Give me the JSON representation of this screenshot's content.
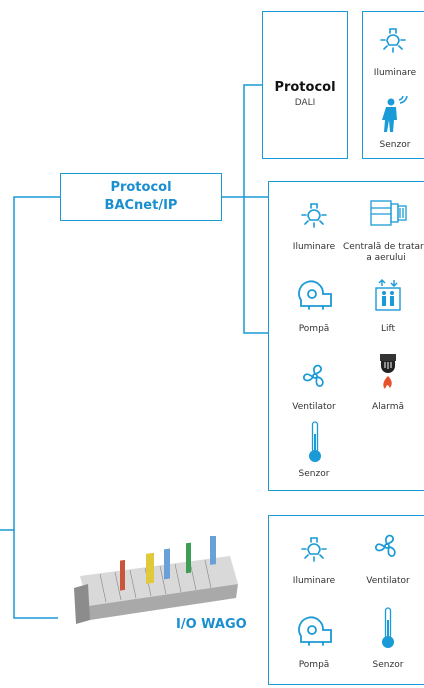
{
  "bacnet": {
    "line1": "Protocol",
    "line2": "BACnet/IP"
  },
  "dali": {
    "title": "Protocol",
    "subtitle": "DALI"
  },
  "dali_devices": {
    "lighting": "Iluminare",
    "sensor": "Senzor"
  },
  "bacnet_devices": {
    "lighting": "Iluminare",
    "ahu_line1": "Centrală de tratare",
    "ahu_line2": "a aerului",
    "pump": "Pompă",
    "lift": "Lift",
    "fan": "Ventilator",
    "alarm": "Alarmă",
    "sensor": "Senzor"
  },
  "wago": {
    "label": "I/O WAGO"
  },
  "wago_devices": {
    "lighting": "Iluminare",
    "fan": "Ventilator",
    "pump": "Pompă",
    "sensor": "Senzor"
  },
  "colors": {
    "accent": "#1a9ad6",
    "title": "#1a8fd0",
    "alarm_flame": "#e8502a"
  }
}
